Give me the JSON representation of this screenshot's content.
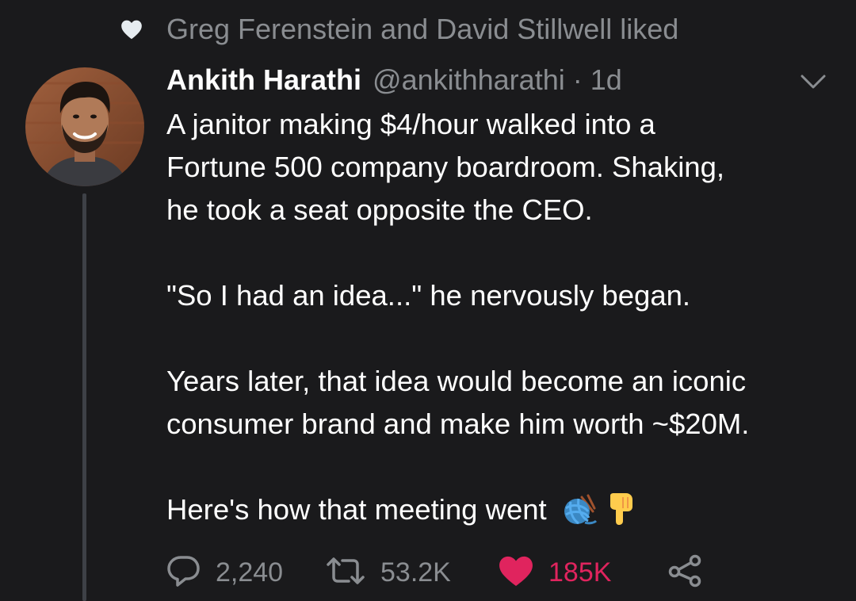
{
  "social_context": {
    "icon": "heart-icon",
    "text": "Greg Ferenstein and David Stillwell liked"
  },
  "author": {
    "name": "Ankith Harathi",
    "handle": "@ankithharathi",
    "separator": "·",
    "time": "1d"
  },
  "tweet": {
    "paragraphs": [
      [
        "A janitor making $4/hour walked into a",
        "Fortune 500 company boardroom. Shaking,",
        "he took a seat opposite the CEO."
      ],
      [
        "\"So I had an idea...\" he nervously began."
      ],
      [
        "Years later, that idea would become an iconic",
        "consumer brand and make him worth ~$20M."
      ],
      [
        "Here's how that meeting went"
      ]
    ],
    "emojis": [
      "yarn-ball-emoji",
      "pointing-down-emoji"
    ]
  },
  "actions": {
    "replies": "2,240",
    "retweets": "53.2K",
    "likes": "185K",
    "liked": true,
    "share_icon": "share-icon"
  },
  "colors": {
    "background": "#1a1a1c",
    "secondary_text": "#8a8d91",
    "like_color": "#e0245e",
    "thread_line": "#3e4147"
  }
}
